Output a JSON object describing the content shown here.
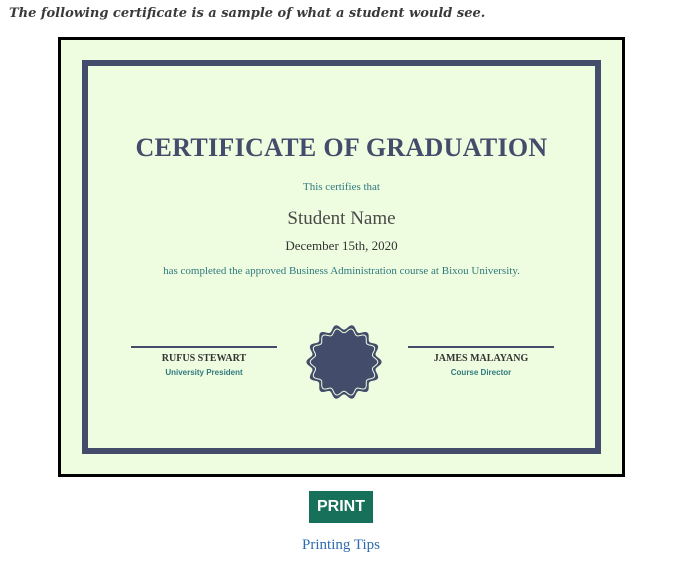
{
  "intro_text": "The following certificate is a sample of what a student would see.",
  "certificate": {
    "title": "CERTIFICATE OF GRADUATION",
    "certifies_text": "This certifies that",
    "student_name": "Student Name",
    "date": "December 15th, 2020",
    "completion_text": "has completed the approved Business Administration course at Bixou University.",
    "signatories": [
      {
        "name": "RUFUS STEWART",
        "role": "University President"
      },
      {
        "name": "JAMES MALAYANG",
        "role": "Course Director"
      }
    ],
    "seal_icon": "seal-icon",
    "colors": {
      "background": "#eefcdf",
      "border": "#434d6b",
      "accent": "#2f7a7f"
    }
  },
  "actions": {
    "print_label": "PRINT",
    "tips_link": "Printing Tips"
  }
}
